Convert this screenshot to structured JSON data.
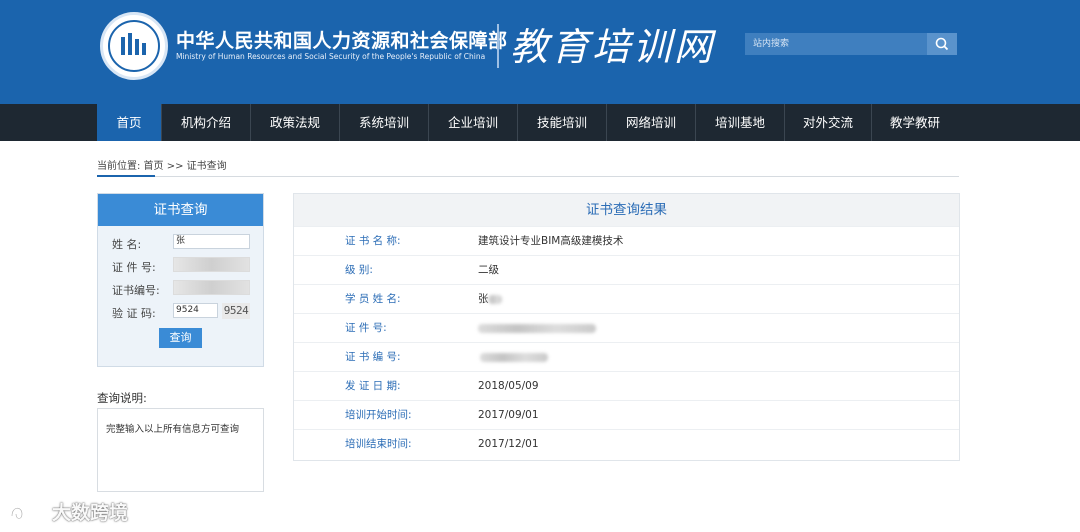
{
  "header": {
    "org_name_cn": "中华人民共和国人力资源和社会保障部",
    "org_name_en": "Ministry of Human Resources and Social Security of the People's Republic of China",
    "site_title": "教育培训网",
    "search_placeholder": "站内搜索",
    "brand_color": "#1b64ad"
  },
  "nav": {
    "items": [
      "首页",
      "机构介绍",
      "政策法规",
      "系统培训",
      "企业培训",
      "技能培训",
      "网络培训",
      "培训基地",
      "对外交流",
      "教学教研"
    ],
    "active": "首页"
  },
  "breadcrumb": "当前位置: 首页 >> 证书查询",
  "query": {
    "title": "证书查询",
    "name_label": "姓    名:",
    "name_value": "张",
    "id_label": "证 件 号:",
    "cert_no_label": "证书编号:",
    "code_label": "验 证 码:",
    "code_value": "9524",
    "captcha": "9524",
    "submit": "查询"
  },
  "notes": {
    "label": "查询说明:",
    "text": "完整输入以上所有信息方可查询"
  },
  "result": {
    "title": "证书查询结果",
    "rows": [
      {
        "label": "证 书 名 称:",
        "value": "建筑设计专业BIM高级建模技术"
      },
      {
        "label": "级       别:",
        "value": "二级"
      },
      {
        "label": "学 员 姓 名:",
        "value": "张"
      },
      {
        "label": "证    件    号:",
        "value": ""
      },
      {
        "label": "证 书 编  号:",
        "value": ""
      },
      {
        "label": "发 证 日  期:",
        "value": "2018/05/09"
      },
      {
        "label": "培训开始时间:",
        "value": "2017/09/01"
      },
      {
        "label": "培训结束时间:",
        "value": "2017/12/01"
      }
    ]
  },
  "watermark": "大数跨境"
}
